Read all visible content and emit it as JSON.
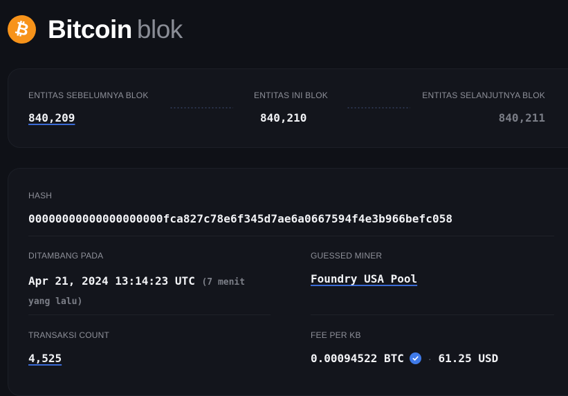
{
  "header": {
    "logo_icon": "bitcoin-icon",
    "logo_glyph": "₿",
    "brand_title": "Bitcoin",
    "brand_sub": "blok"
  },
  "nav": {
    "prev_label": "ENTITAS SEBELUMNYA BLOK",
    "prev_value": "840,209",
    "current_label": "ENTITAS INI BLOK",
    "current_value": "840,210",
    "next_label": "ENTITAS SELANJUTNYA BLOK",
    "next_value": "840,211"
  },
  "details": {
    "hash_label": "HASH",
    "hash_value": "00000000000000000000fca827c78e6f345d7ae6a0667594f4e3b966befc058",
    "added_label": "DITAMBANG PADA",
    "added_value": "Apr 21, 2024 13:14:23 UTC",
    "added_ago": "(7 menit yang lalu)",
    "miner_label": "GUESSED MINER",
    "miner_value": "Foundry USA Pool",
    "tx_label": "TRANSAKSI COUNT",
    "tx_value": "4,525",
    "fee_label": "FEE PER KB",
    "fee_btc": "0.00094522 BTC",
    "fee_separator": "·",
    "fee_usd": "61.25 USD",
    "verified_icon": "check-badge-icon"
  },
  "colors": {
    "background": "#0f1117",
    "card": "#13151c",
    "bitcoin_orange": "#f7931a",
    "link_underline": "#3b6bd6",
    "verified_blue": "#3f7ae8"
  }
}
